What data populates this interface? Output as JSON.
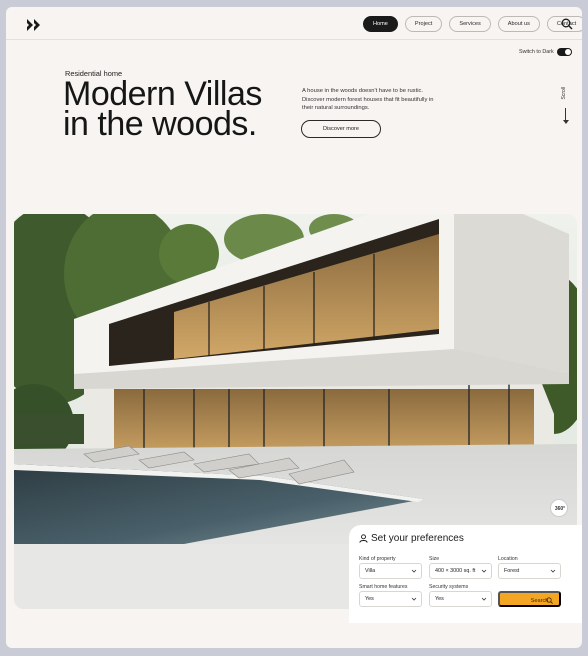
{
  "header": {
    "nav": [
      "Home",
      "Project",
      "Services",
      "About us",
      "Contact"
    ],
    "active": "Home"
  },
  "theme_switch": {
    "label": "Switch to Dark"
  },
  "hero_text": {
    "eyebrow": "Residential home",
    "headline_line1": "Modern Villas",
    "headline_line2": "in the woods.",
    "description": "A house in the woods doesn't have to be rustic. Discover modern forest houses that fit beautifully in their natural surroundings.",
    "cta": "Discover more"
  },
  "scroll_label": "Scroll",
  "badge_text": "360°",
  "preferences": {
    "title": "Set your preferences",
    "fields": {
      "kind": {
        "label": "Kind of property",
        "value": "Villa"
      },
      "size": {
        "label": "Size",
        "value": "400 × 3000 sq. ft"
      },
      "location": {
        "label": "Location",
        "value": "Forest"
      },
      "features": {
        "label": "Smart home features",
        "value": "Yes"
      },
      "security": {
        "label": "Security systems",
        "value": "Yes"
      }
    },
    "search": "Search"
  },
  "colors": {
    "accent": "#f5a524",
    "dark": "#1a1a1a",
    "page_bg": "#f7f4f1"
  }
}
